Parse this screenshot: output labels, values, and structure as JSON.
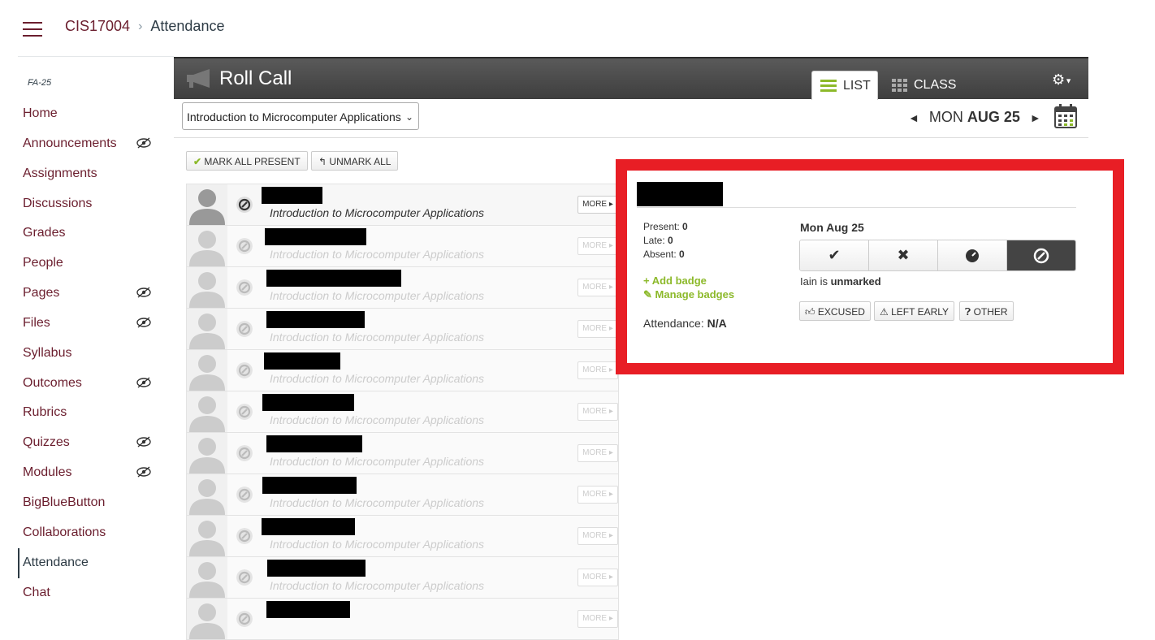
{
  "breadcrumb": {
    "course": "CIS17004",
    "page": "Attendance"
  },
  "sidebar": {
    "term": "FA-25",
    "items": [
      {
        "label": "Home",
        "hidden": false
      },
      {
        "label": "Announcements",
        "hidden": true
      },
      {
        "label": "Assignments",
        "hidden": false
      },
      {
        "label": "Discussions",
        "hidden": false
      },
      {
        "label": "Grades",
        "hidden": false
      },
      {
        "label": "People",
        "hidden": false
      },
      {
        "label": "Pages",
        "hidden": true
      },
      {
        "label": "Files",
        "hidden": true
      },
      {
        "label": "Syllabus",
        "hidden": false
      },
      {
        "label": "Outcomes",
        "hidden": true
      },
      {
        "label": "Rubrics",
        "hidden": false
      },
      {
        "label": "Quizzes",
        "hidden": true
      },
      {
        "label": "Modules",
        "hidden": true
      },
      {
        "label": "BigBlueButton",
        "hidden": false
      },
      {
        "label": "Collaborations",
        "hidden": false
      },
      {
        "label": "Attendance",
        "hidden": false,
        "active": true
      },
      {
        "label": "Chat",
        "hidden": false
      }
    ]
  },
  "rollcall": {
    "title": "Roll Call",
    "tabs": {
      "list": "LIST",
      "class": "CLASS"
    },
    "section_select": "Introduction to Microcomputer Applications",
    "date_prefix": "MON",
    "date_bold": "AUG 25",
    "mark_all_present": "MARK ALL PRESENT",
    "unmark_all": "UNMARK ALL",
    "more_label": "MORE ▸"
  },
  "students": [
    {
      "course": "Introduction to Microcomputer Applications",
      "active": true
    },
    {
      "course": "Introduction to Microcomputer Applications"
    },
    {
      "course": "Introduction to Microcomputer Applications"
    },
    {
      "course": "Introduction to Microcomputer Applications"
    },
    {
      "course": "Introduction to Microcomputer Applications"
    },
    {
      "course": "Introduction to Microcomputer Applications"
    },
    {
      "course": "Introduction to Microcomputer Applications"
    },
    {
      "course": "Introduction to Microcomputer Applications"
    },
    {
      "course": "Introduction to Microcomputer Applications"
    },
    {
      "course": "Introduction to Microcomputer Applications"
    },
    {
      "course": ""
    }
  ],
  "detail": {
    "present_label": "Present:",
    "present": "0",
    "late_label": "Late:",
    "late": "0",
    "absent_label": "Absent:",
    "absent": "0",
    "add_badge": "+ Add badge",
    "manage_badges": "Manage badges",
    "attendance_label": "Attendance:",
    "attendance": "N/A",
    "date": "Mon Aug 25",
    "status_prefix": "Iain is",
    "status": "unmarked",
    "excused": "EXCUSED",
    "left_early": "LEFT EARLY",
    "other": "OTHER"
  },
  "colors": {
    "accent": "#6b1e2e",
    "highlight": "#e81e25",
    "badge_green": "#8cb92a"
  }
}
